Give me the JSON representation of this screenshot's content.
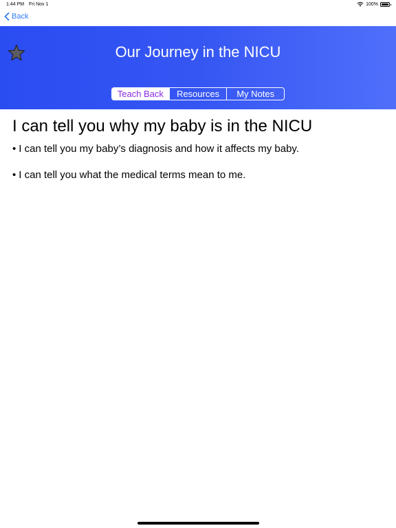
{
  "status_bar": {
    "time": "1:44 PM",
    "date": "Fri Nov 1",
    "battery": "100%"
  },
  "nav": {
    "back_label": "Back",
    "accent_color": "#2f7cf6"
  },
  "header": {
    "title": "Our Journey in the NICU",
    "star_icon": "star-icon",
    "tabs": [
      {
        "label": "Teach Back",
        "selected": true
      },
      {
        "label": "Resources",
        "selected": false
      },
      {
        "label": "My Notes",
        "selected": false
      }
    ],
    "gradient_colors": [
      "#2a4df2",
      "#4f6ffb"
    ],
    "selected_tab_color": "#8a2be2"
  },
  "content": {
    "heading": "I can tell you why my baby is in the NICU",
    "bullets": [
      "I can tell you my baby’s diagnosis and how it affects my baby.",
      "I can tell you what the medical terms mean to me."
    ]
  }
}
